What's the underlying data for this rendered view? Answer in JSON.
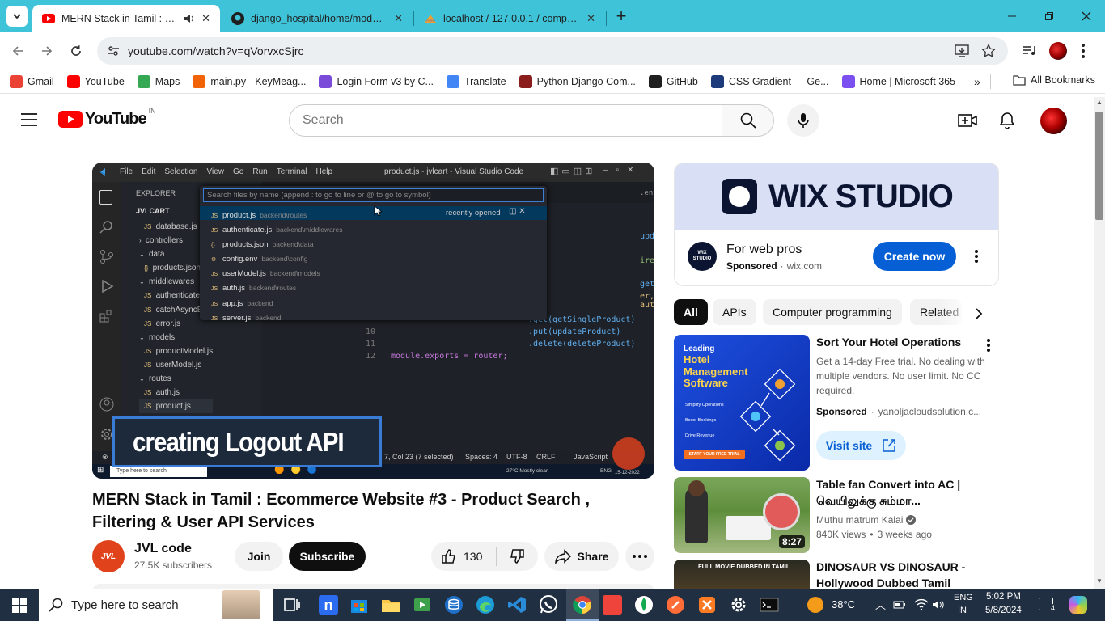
{
  "browser": {
    "tabs": [
      {
        "title": "MERN Stack in Tamil : Ecom",
        "active": true
      },
      {
        "title": "django_hospital/home/models.",
        "active": false
      },
      {
        "title": "localhost / 127.0.0.1 / company",
        "active": false
      }
    ],
    "url": "youtube.com/watch?v=qVorvxcSjrc",
    "bookmarks": [
      {
        "label": "Gmail",
        "icon": "gmail-icon"
      },
      {
        "label": "YouTube",
        "icon": "youtube-icon"
      },
      {
        "label": "Maps",
        "icon": "maps-icon"
      },
      {
        "label": "main.py - KeyMeag...",
        "icon": "replit-icon"
      },
      {
        "label": "Login Form v3 by C...",
        "icon": "colorlib-icon"
      },
      {
        "label": "Translate",
        "icon": "translate-icon"
      },
      {
        "label": "Python Django Com...",
        "icon": "python-icon"
      },
      {
        "label": "GitHub",
        "icon": "github-icon"
      },
      {
        "label": "CSS Gradient — Ge...",
        "icon": "css-gradient-icon"
      },
      {
        "label": "Home | Microsoft 365",
        "icon": "microsoft365-icon"
      }
    ],
    "all_bookmarks": "All Bookmarks"
  },
  "yt": {
    "logo_text": "YouTube",
    "region": "IN",
    "search_placeholder": "Search"
  },
  "video": {
    "overlay_text": "creating Logout API",
    "vscode": {
      "menu": [
        "File",
        "Edit",
        "Selection",
        "View",
        "Go",
        "Run",
        "Terminal",
        "Help"
      ],
      "window_title": "product.js - jvlcart - Visual Studio Code",
      "explorer_label": "EXPLORER",
      "project": "JVLCART",
      "tree": [
        "database.js",
        "controllers",
        "data",
        "products.json",
        "middlewares",
        "authenticate.js",
        "catchAsyncE",
        "error.js",
        "models",
        "productModel.js",
        "userModel.js",
        "routes",
        "auth.js",
        "product.js"
      ],
      "quickopen_placeholder": "Search files by name (append : to go to line or @ to go to symbol)",
      "recently_opened": "recently opened",
      "results": [
        {
          "file": "product.js",
          "path": "backend\\routes"
        },
        {
          "file": "authenticate.js",
          "path": "backend\\middlewares"
        },
        {
          "file": "products.json",
          "path": "backend\\data"
        },
        {
          "file": "config.env",
          "path": "backend\\config"
        },
        {
          "file": "userModel.js",
          "path": "backend\\models"
        },
        {
          "file": "auth.js",
          "path": "backend\\routes"
        },
        {
          "file": "app.js",
          "path": "backend"
        },
        {
          "file": "server.js",
          "path": "backend"
        }
      ],
      "code_lines": [
        {
          "num": "10",
          "text": ".put(updateProduct)"
        },
        {
          "num": "11",
          "text": ".delete(deleteProduct)"
        },
        {
          "num": "12",
          "text": "module.exports = router;"
        }
      ],
      "code_fragments": [
        "updateProduc",
        "ire('../mid",
        "getProducts)",
        "er, authoriz",
        ".get(getSingleProduct)",
        ".env"
      ],
      "status": {
        "position": "7, Col 23 (7 selected)",
        "spaces": "Spaces: 4",
        "encoding": "UTF-8",
        "eol": "CRLF",
        "language": "JavaScript"
      },
      "taskbar_search": "Type here to search",
      "weather": "27°C Mostly clear",
      "lang": "ENG",
      "date": "15-12-2022"
    },
    "title": "MERN Stack in Tamil : Ecommerce Website #3 - Product Search , Filtering & User API Services",
    "channel": "JVL code",
    "subscribers": "27.5K subscribers",
    "join": "Join",
    "subscribe": "Subscribe",
    "likes": "130",
    "share": "Share"
  },
  "ad": {
    "brand": "WIX STUDIO",
    "headline": "For web pros",
    "sponsored": "Sponsored",
    "domain": "wix.com",
    "cta": "Create now",
    "logo_text": "WIX STUDIO"
  },
  "chips": [
    "All",
    "APIs",
    "Computer programming",
    "Related"
  ],
  "recommendations": [
    {
      "title": "Sort Your Hotel Operations",
      "desc": "Get a 14-day Free trial. No dealing with multiple vendors. No user limit. No CC required.",
      "sponsored": "Sponsored",
      "domain": "yanoljacloudsolution.c...",
      "cta": "Visit site",
      "thumb_small": "Leading",
      "thumb_big": "Hotel Management Software",
      "thumb_items": [
        "Simplify Operations",
        "Boost Bookings",
        "Drive Revenue"
      ],
      "thumb_btn": "START YOUR FREE TRIAL"
    },
    {
      "title": "Table fan Convert into AC | வெயிலுக்கு சும்மா...",
      "channel": "Muthu matrum Kalai",
      "views": "840K views",
      "age": "3 weeks ago",
      "duration": "8:27"
    },
    {
      "title": "DINOSAUR VS DINOSAUR - Hollywood Dubbed Tamil Movi...",
      "thumb_text": "FULL MOVIE DUBBED IN TAMIL"
    }
  ],
  "taskbar": {
    "search": "Type here to search",
    "temp": "38°C",
    "lang1": "ENG",
    "lang2": "IN",
    "time": "5:02 PM",
    "date": "5/8/2024",
    "notif_count": "4"
  },
  "colors": {
    "tabstrip": "#3fc3d8",
    "yt_red": "#ff0000",
    "subscribe_bg": "#0f0f0f",
    "cta_blue": "#065fd4",
    "taskbar": "#212f42"
  }
}
